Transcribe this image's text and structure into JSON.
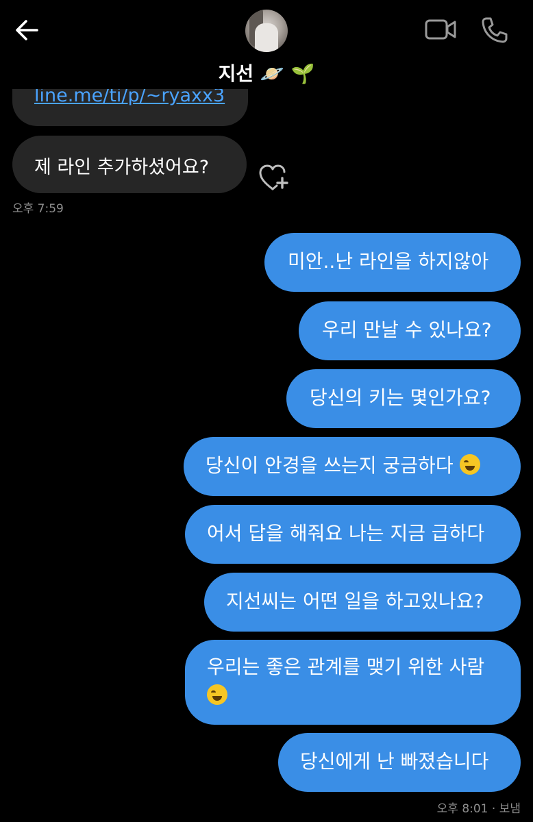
{
  "header": {
    "contact_name": "지선 🪐 🌱"
  },
  "messages_in": {
    "link_text": "line.me/ti/p/~ryaxx3",
    "text": "제 라인 추가하셨어요?",
    "time": "오후 7:59"
  },
  "messages_out": [
    "미안..난 라인을 하지않아",
    "우리 만날 수 있나요?",
    "당신의 키는 몇인가요?",
    "당신이 안경을 쓰는지 궁금하다",
    "어서 답을 해줘요 나는 지금 급하다",
    "지선씨는 어떤 일을 하고있나요?",
    "우리는 좋은 관계를 맺기 위한 사람",
    "당신에게 난 빠졌습니다"
  ],
  "footer": {
    "status": "오후 8:01 · 보냄"
  },
  "icons": {
    "back": "arrow-left-icon",
    "video": "video-camera-icon",
    "phone": "phone-icon",
    "like": "heart-plus-icon",
    "grin_emoji": "grinning-squinting-face",
    "laugh_emoji": "face-with-tears-of-joy"
  },
  "colors": {
    "background": "#000000",
    "incoming_bubble": "#262626",
    "outgoing_bubble": "#3a8ee6",
    "link": "#4aa3ff"
  }
}
